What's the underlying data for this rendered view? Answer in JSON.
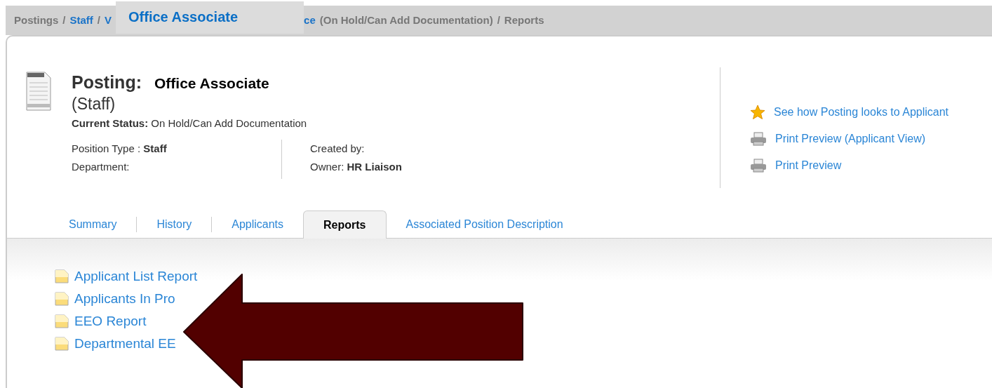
{
  "breadcrumb": [
    {
      "kind": "plain",
      "text": "Postings"
    },
    {
      "kind": "sep",
      "text": "/"
    },
    {
      "kind": "link",
      "text": "Staff"
    },
    {
      "kind": "sep",
      "text": "/"
    },
    {
      "kind": "link",
      "text": "V"
    },
    {
      "kind": "overlay",
      "text": "Office Associate"
    },
    {
      "kind": "link",
      "text": "ce"
    },
    {
      "kind": "plain",
      "text": "(On Hold/Can Add Documentation)"
    },
    {
      "kind": "sep",
      "text": "/"
    },
    {
      "kind": "plain",
      "text": "Reports"
    }
  ],
  "header": {
    "title": "Posting:",
    "title_overlay": "Office Associate",
    "subtitle": "(Staff)",
    "status_label": "Current Status:",
    "status_value": "On Hold/Can Add Documentation",
    "fields_left": [
      {
        "label": "Position Type :",
        "value": "Staff"
      },
      {
        "label": "Department:"
      }
    ],
    "fields_right": [
      {
        "label": "Created by:"
      },
      {
        "label": "Owner:",
        "value": "HR Liaison"
      }
    ]
  },
  "actions": [
    {
      "kind": "star",
      "text": "See how Posting looks to Applicant"
    },
    {
      "kind": "printer",
      "text": "Print Preview (Applicant View)"
    },
    {
      "kind": "printer",
      "text": "Print Preview"
    }
  ],
  "tabs": [
    {
      "label": "Summary",
      "selected": false
    },
    {
      "label": "History",
      "selected": false
    },
    {
      "label": "Applicants",
      "selected": false
    },
    {
      "label": "Reports",
      "selected": true
    },
    {
      "label": "Associated Position Description",
      "selected": false
    }
  ],
  "reports": [
    "Applicant List Report",
    "Applicants In Pro",
    "EEO Report",
    "Departmental EE"
  ]
}
